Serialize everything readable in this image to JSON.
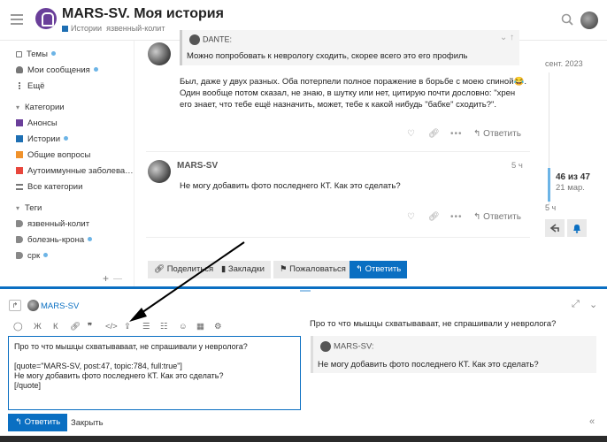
{
  "header": {
    "site_title": "MARS-SV. Моя история",
    "breadcrumb_category": "Истории",
    "breadcrumb_tag": "язвенный-колит"
  },
  "sidebar": {
    "items": [
      {
        "label": "Темы",
        "dot": true
      },
      {
        "label": "Мои сообщения",
        "dot": true
      },
      {
        "label": "Ещё",
        "dot": false
      }
    ],
    "categories_heading": "Категории",
    "categories": [
      {
        "label": "Анонсы",
        "color": "#6a3f9a",
        "dot": false
      },
      {
        "label": "Истории",
        "color": "#1e6fb3",
        "dot": true
      },
      {
        "label": "Общие вопросы",
        "color": "#f0922b",
        "dot": false
      },
      {
        "label": "Аутоиммунные заболева…",
        "color": "#e8463c",
        "dot": false
      },
      {
        "label": "Все категории",
        "color": "",
        "dot": false
      }
    ],
    "tags_heading": "Теги",
    "tags": [
      {
        "label": "язвенный-колит",
        "dot": false
      },
      {
        "label": "болезнь-крона",
        "dot": true
      },
      {
        "label": "срк",
        "dot": true
      }
    ]
  },
  "post1": {
    "quote_author": "DANTE:",
    "quote_text": "Можно попробовать к неврологу сходить, скорее всего это его профиль",
    "body": "Был, даже у двух разных. Оба потерпели полное поражение в борьбе с моею спиной😂. Один вообще потом сказал, не знаю, в шутку или нет, цитирую почти дословно: \"хрен его знает, что тебе ещё назначить, может, тебе к какой нибудь \"бабке\" сходить?\".",
    "reply_label": "Ответить"
  },
  "post2": {
    "author": "MARS-SV",
    "time": "5 ч",
    "body": "Не могу добавить фото последнего КТ. Как это сделать?",
    "reply_label": "Ответить"
  },
  "topic_buttons": {
    "share": "Поделиться",
    "bookmark": "Закладки",
    "flag": "Пожаловаться",
    "reply": "Ответить"
  },
  "timeline": {
    "top_date": "сент. 2023",
    "position": "46 из 47",
    "date": "21 мар.",
    "last": "5 ч"
  },
  "composer": {
    "user": "MARS-SV",
    "toolbar": [
      "Ж",
      "К"
    ],
    "editor_text": "Про то что мышцы схватываваат, не спрашивали у невролога?\n\n[quote=\"MARS-SV, post:47, topic:784, full:true\"]\nНе могу добавить фото последнего КТ. Как это сделать?\n[/quote]",
    "preview_text": "Про то что мышцы схватываваат, не спрашивали у невролога?",
    "preview_quote_author": "MARS-SV:",
    "preview_quote_text": "Не могу добавить фото последнего КТ. Как это сделать?",
    "submit_label": "Ответить",
    "close_label": "Закрыть"
  },
  "colors": {
    "accent": "#0a6fc2",
    "unread_dot": "#6cb4e6"
  }
}
